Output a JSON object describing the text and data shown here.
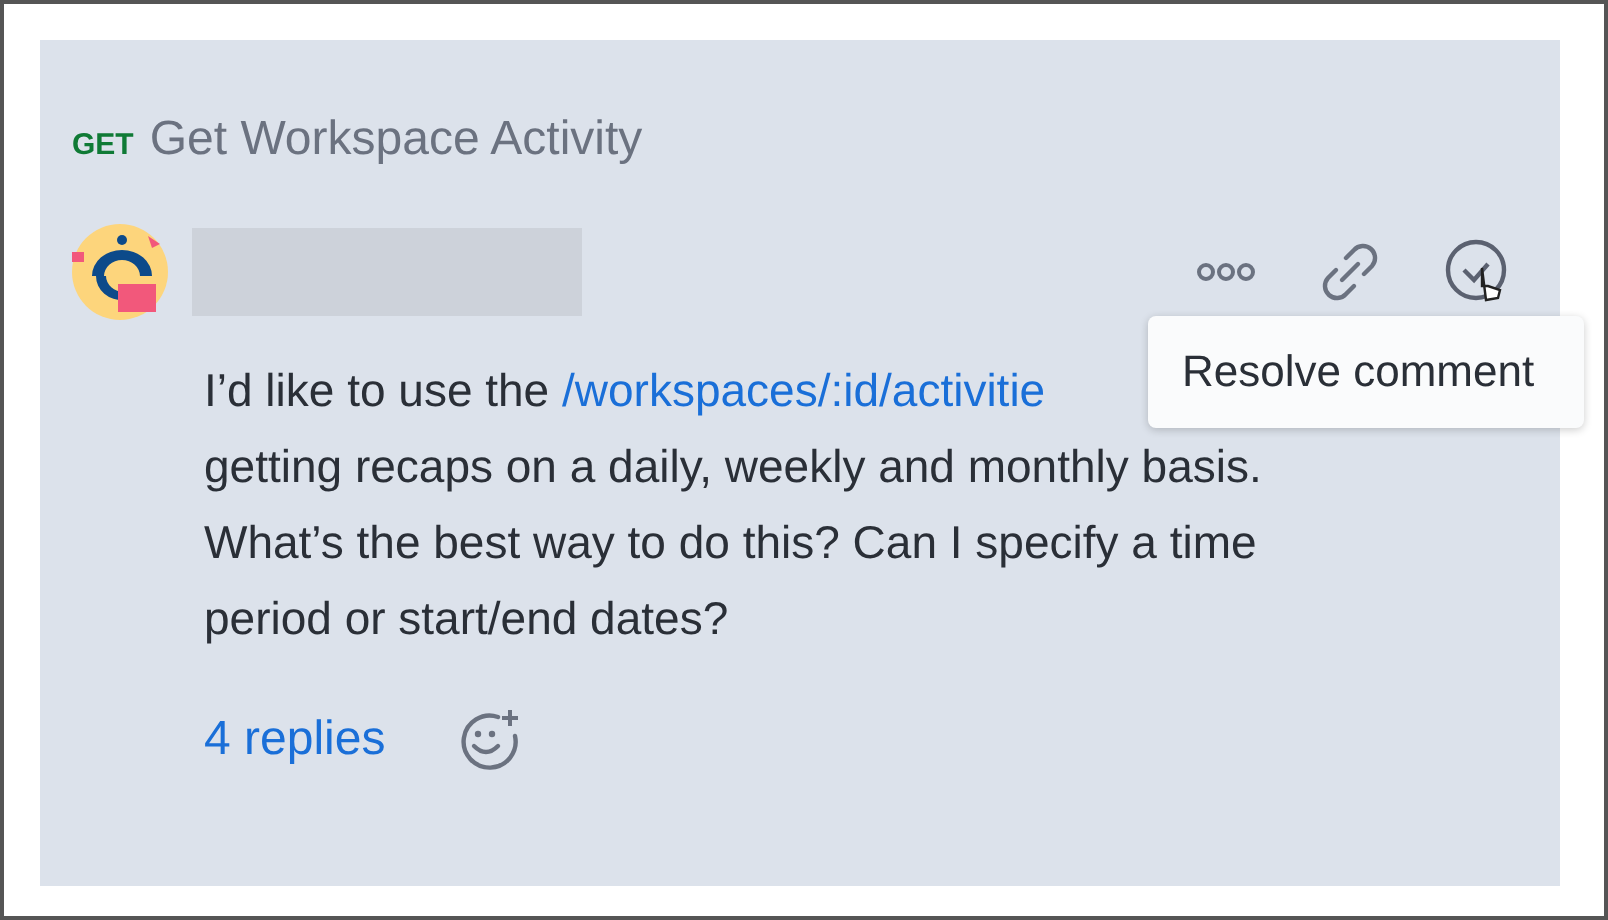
{
  "request": {
    "method": "GET",
    "title": "Get Workspace Activity"
  },
  "comment": {
    "lines": [
      [
        {
          "text": "I’d like to use the "
        },
        {
          "text": "/workspaces/:id/activitie",
          "link": true
        }
      ],
      [
        {
          "text": "getting recaps on a daily, weekly and monthly basis."
        }
      ],
      [
        {
          "text": "What’s the best way to do this? Can I specify a time"
        }
      ],
      [
        {
          "text": "period or start/end dates?"
        }
      ]
    ],
    "replies": "4 replies"
  },
  "tooltip": "Resolve comment"
}
